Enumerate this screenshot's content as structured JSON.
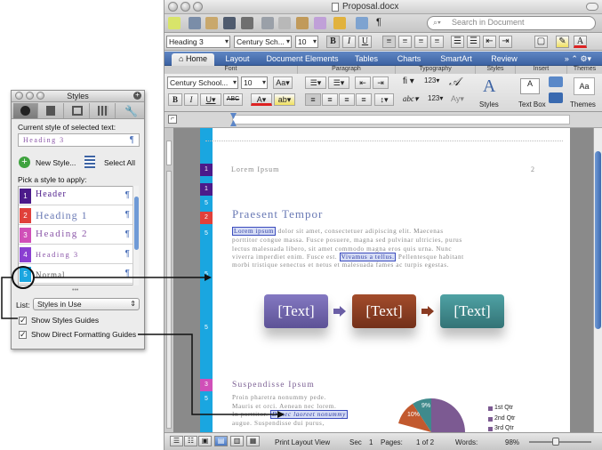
{
  "window": {
    "title": "Proposal.docx"
  },
  "search": {
    "placeholder": "Search in Document"
  },
  "format_bar": {
    "style": "Heading 3",
    "font": "Century Sch...",
    "size": "10",
    "bold": "B",
    "italic": "I",
    "underline": "U"
  },
  "tabs": [
    {
      "label": "Home"
    },
    {
      "label": "Layout"
    },
    {
      "label": "Document Elements"
    },
    {
      "label": "Tables"
    },
    {
      "label": "Charts"
    },
    {
      "label": "SmartArt"
    },
    {
      "label": "Review"
    }
  ],
  "ribbon": {
    "groups": [
      "Font",
      "Paragraph",
      "Typography",
      "Styles",
      "Insert",
      "Themes"
    ],
    "font": "Century School...",
    "size": "10",
    "styles_label": "Styles",
    "textbox_label": "Text Box",
    "themes_label": "Themes"
  },
  "page": {
    "header": "Lorem Ipsum",
    "page_number": "2",
    "heading1": "Praesent Tempor",
    "para1_line1_hl": "Lorem ipsum",
    "para1_line1": " dolor sit amet, consectetuer adipiscing elit. Maecenas",
    "para1_line2": "porttitor congue massa. Fusce posuere, magna sed pulvinar ultricies, purus",
    "para1_line3": "lectus malesuada libero, sit amet commodo magna eros quis urna. Nunc",
    "para1_line4a": "viverra imperdiet enim. Fusce est. ",
    "para1_line4_hl": "Vivamus a tellus.",
    "para1_line4b": " Pellentesque habitant",
    "para1_line5": "morbi tristique senectus et netus et malesuada fames ac turpis egestas.",
    "smartart": [
      "[Text]",
      "[Text]",
      "[Text]"
    ],
    "heading2": "Suspendisse Ipsum",
    "para2_line1": "Proin pharetra nonummy pede.",
    "para2_line2": "Mauris et orci. Aenean nec lorem.",
    "para2_line3a": "In porttitor. ",
    "para2_line3_hl": "Donec laoreet nonummy",
    "para2_line4": "augue. Suspendisse dui purus,",
    "pie_labels": [
      "9%",
      "10%"
    ],
    "legend": [
      "1st Qtr",
      "2nd Qtr",
      "3rd Qtr"
    ]
  },
  "guides": [
    "1",
    "1",
    "5",
    "2",
    "5",
    "5",
    "5",
    "3",
    "5"
  ],
  "status": {
    "view": "Print Layout View",
    "sec_label": "Sec",
    "sec": "1",
    "pages_label": "Pages:",
    "pages": "1 of 2",
    "words_label": "Words:",
    "zoom": "98%"
  },
  "styles_palette": {
    "title": "Styles",
    "current_label": "Current style of selected text:",
    "current_value": "Heading 3",
    "new_style": "New Style...",
    "select_all": "Select All",
    "pick_label": "Pick a style to apply:",
    "items": [
      {
        "num": "1",
        "label": "Header",
        "color": "#4b1a8a"
      },
      {
        "num": "2",
        "label": "Heading 1",
        "color": "#e0403a"
      },
      {
        "num": "3",
        "label": "Heading 2",
        "color": "#d04fb8"
      },
      {
        "num": "4",
        "label": "Heading 3",
        "color": "#8a3fd1"
      },
      {
        "num": "5",
        "label": "Normal",
        "color": "#1aa6e0"
      }
    ],
    "list_label": "List:",
    "list_value": "Styles in Use",
    "show_styles_guides": "Show Styles Guides",
    "show_direct_guides": "Show Direct Formatting Guides"
  },
  "colors": {
    "guide_blue": "#1aa6e0",
    "smart1": "#6b5fa6",
    "smart2": "#8a3b22",
    "smart3": "#3f8a8c",
    "tab_blue": "#3d63a3"
  }
}
